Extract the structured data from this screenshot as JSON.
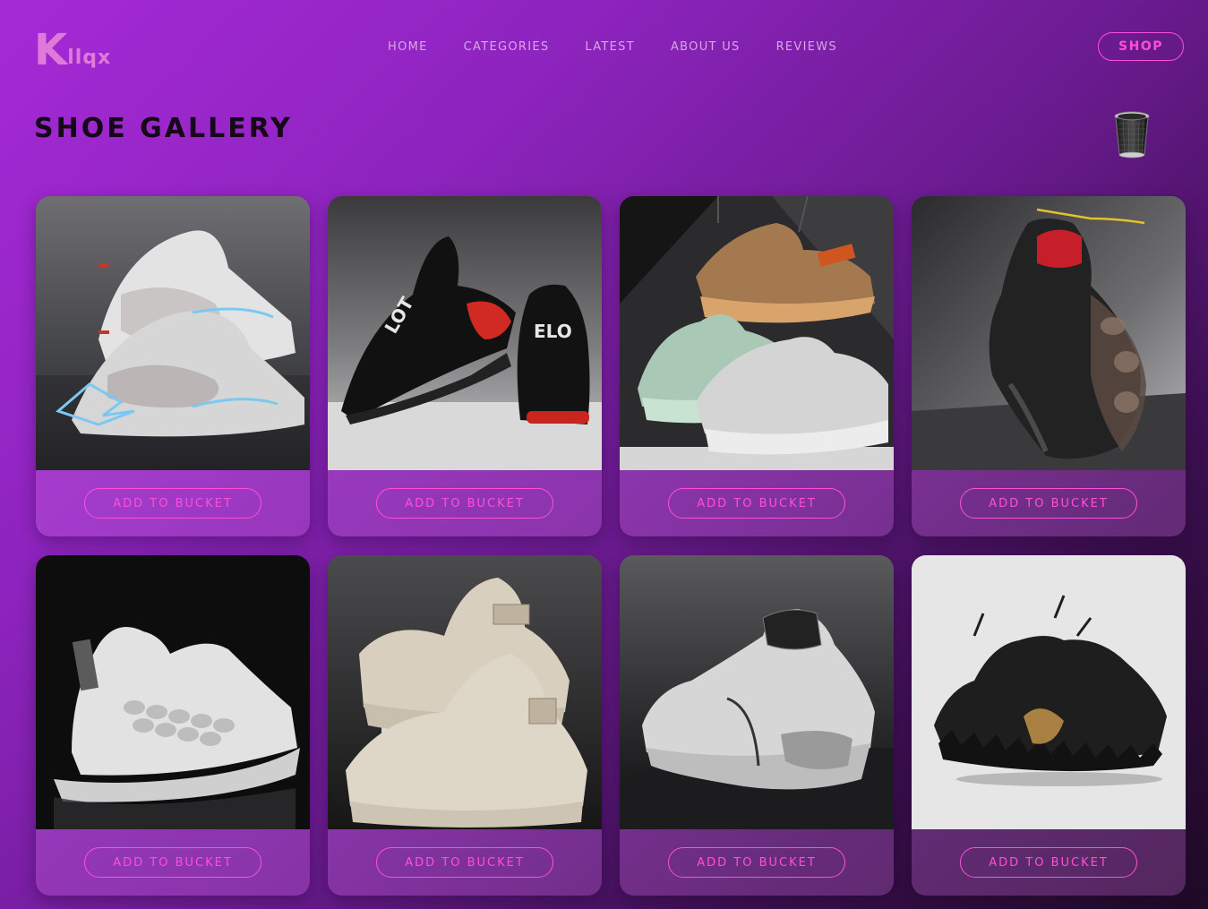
{
  "brand": {
    "logo_main": "K",
    "logo_rest": "llqx"
  },
  "nav": {
    "items": [
      {
        "label": "Home"
      },
      {
        "label": "Categories"
      },
      {
        "label": "Latest"
      },
      {
        "label": "About Us"
      },
      {
        "label": "Reviews"
      }
    ]
  },
  "header": {
    "shop_label": "Shop"
  },
  "page": {
    "title": "Shoe Gallery",
    "bucket_icon": "trash-bucket-icon"
  },
  "colors": {
    "accent": "#ff4fd8",
    "logo": "#e07ad8",
    "title": "#160818",
    "bg_start": "#a52ad6",
    "bg_end": "#1f0a25"
  },
  "gallery": {
    "items": [
      {
        "image": "white-grey-sneaker-pair-image",
        "button_label": "Add to Bucket"
      },
      {
        "image": "black-red-sneaker-pair-image",
        "button_label": "Add to Bucket"
      },
      {
        "image": "brown-mint-grey-sneakers-image",
        "button_label": "Add to Bucket"
      },
      {
        "image": "black-high-top-sneaker-image",
        "button_label": "Add to Bucket"
      },
      {
        "image": "white-scale-sneaker-image",
        "button_label": "Add to Bucket"
      },
      {
        "image": "beige-high-top-sneakers-image",
        "button_label": "Add to Bucket"
      },
      {
        "image": "grey-chunky-sneaker-image",
        "button_label": "Add to Bucket"
      },
      {
        "image": "black-spiky-sneaker-image",
        "button_label": "Add to Bucket"
      }
    ]
  }
}
